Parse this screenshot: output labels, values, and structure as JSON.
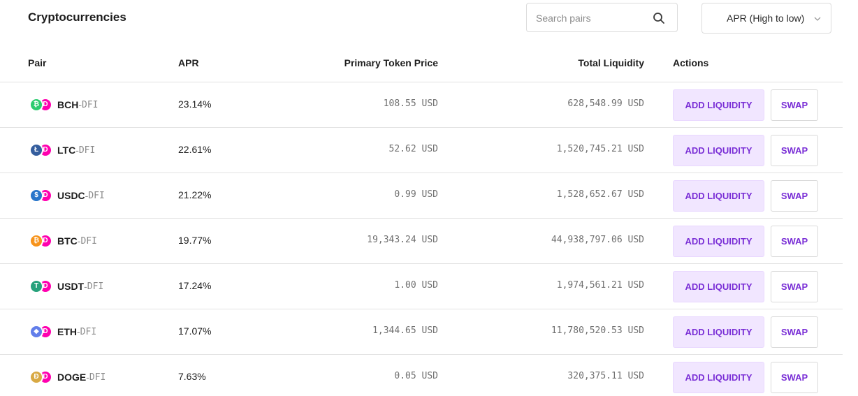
{
  "title": "Cryptocurrencies",
  "search": {
    "placeholder": "Search pairs",
    "value": ""
  },
  "sort": {
    "selected": "APR (High to low)"
  },
  "columns": {
    "pair": "Pair",
    "apr": "APR",
    "price": "Primary Token Price",
    "liquidity": "Total Liquidity",
    "actions": "Actions"
  },
  "rows": [
    {
      "token": "BCH",
      "sep": "-",
      "base": "DFI",
      "apr": "23.14%",
      "price": "108.55 USD",
      "liquidity": "628,548.99 USD",
      "add_label": "ADD LIQUIDITY",
      "swap_label": "SWAP",
      "icon": "bch-icon",
      "color": "#2dcb6f",
      "glyph": "₿"
    },
    {
      "token": "LTC",
      "sep": "-",
      "base": "DFI",
      "apr": "22.61%",
      "price": "52.62 USD",
      "liquidity": "1,520,745.21 USD",
      "add_label": "ADD LIQUIDITY",
      "swap_label": "SWAP",
      "icon": "ltc-icon",
      "color": "#345d9d",
      "glyph": "Ł"
    },
    {
      "token": "USDC",
      "sep": "-",
      "base": "DFI",
      "apr": "21.22%",
      "price": "0.99 USD",
      "liquidity": "1,528,652.67 USD",
      "add_label": "ADD LIQUIDITY",
      "swap_label": "SWAP",
      "icon": "usdc-icon",
      "color": "#2775ca",
      "glyph": "$"
    },
    {
      "token": "BTC",
      "sep": "-",
      "base": "DFI",
      "apr": "19.77%",
      "price": "19,343.24 USD",
      "liquidity": "44,938,797.06 USD",
      "add_label": "ADD LIQUIDITY",
      "swap_label": "SWAP",
      "icon": "btc-icon",
      "color": "#f7931a",
      "glyph": "₿"
    },
    {
      "token": "USDT",
      "sep": "-",
      "base": "DFI",
      "apr": "17.24%",
      "price": "1.00 USD",
      "liquidity": "1,974,561.21 USD",
      "add_label": "ADD LIQUIDITY",
      "swap_label": "SWAP",
      "icon": "usdt-icon",
      "color": "#26a17b",
      "glyph": "T"
    },
    {
      "token": "ETH",
      "sep": "-",
      "base": "DFI",
      "apr": "17.07%",
      "price": "1,344.65 USD",
      "liquidity": "11,780,520.53 USD",
      "add_label": "ADD LIQUIDITY",
      "swap_label": "SWAP",
      "icon": "eth-icon",
      "color": "#627eea",
      "glyph": "◆"
    },
    {
      "token": "DOGE",
      "sep": "-",
      "base": "DFI",
      "apr": "7.63%",
      "price": "0.05 USD",
      "liquidity": "320,375.11 USD",
      "add_label": "ADD LIQUIDITY",
      "swap_label": "SWAP",
      "icon": "doge-icon",
      "color": "#d8a944",
      "glyph": "Ð"
    }
  ],
  "colors": {
    "accent": "#7a2fd6",
    "accent_bg": "#f1e6ff",
    "dfi": "#ff00af"
  }
}
